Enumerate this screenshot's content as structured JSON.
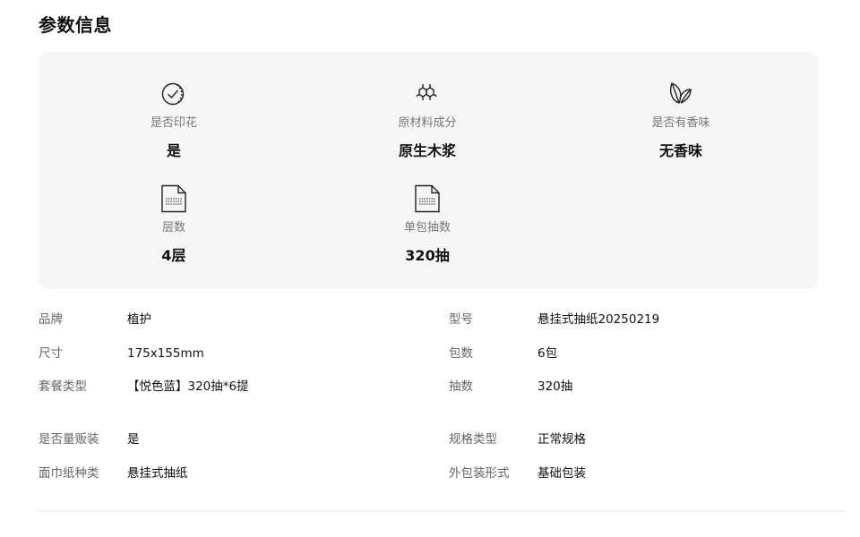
{
  "section": {
    "title": "参数信息"
  },
  "highlights": [
    {
      "icon": "check-circle-icon",
      "label": "是否印花",
      "value": "是"
    },
    {
      "icon": "molecule-icon",
      "label": "原材料成分",
      "value": "原生木浆"
    },
    {
      "icon": "leaf-icon",
      "label": "是否有香味",
      "value": "无香味"
    },
    {
      "icon": "document-icon",
      "label": "层数",
      "value": "4层"
    },
    {
      "icon": "document-icon",
      "label": "单包抽数",
      "value": "320抽"
    }
  ],
  "specs": [
    {
      "label": "品牌",
      "value": "植护"
    },
    {
      "label": "型号",
      "value": "悬挂式抽纸20250219"
    },
    {
      "label": "尺寸",
      "value": "175x155mm"
    },
    {
      "label": "包数",
      "value": "6包"
    },
    {
      "label": "套餐类型",
      "value": "【悦色蓝】320抽*6提"
    },
    {
      "label": "抽数",
      "value": "320抽"
    },
    {
      "label": "是否量贩装",
      "value": "是"
    },
    {
      "label": "规格类型",
      "value": "正常规格"
    },
    {
      "label": "面巾纸种类",
      "value": "悬挂式抽纸"
    },
    {
      "label": "外包装形式",
      "value": "基础包装"
    }
  ]
}
